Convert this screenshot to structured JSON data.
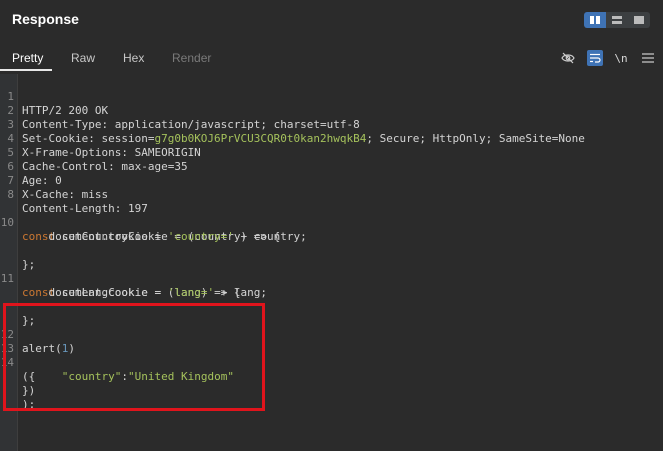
{
  "panel": {
    "title": "Response"
  },
  "tabs": [
    {
      "label": "Pretty",
      "state": "active"
    },
    {
      "label": "Raw",
      "state": "normal"
    },
    {
      "label": "Hex",
      "state": "normal"
    },
    {
      "label": "Render",
      "state": "disabled"
    }
  ],
  "toolbar": {
    "newline_label": "\\n"
  },
  "lines": {
    "l1": {
      "n": "1",
      "text": "HTTP/2 200 OK"
    },
    "l2": {
      "n": "2",
      "a": "Content-Type: application/javascript; charset=utf-8"
    },
    "l3": {
      "n": "3",
      "a": "Set-Cookie: session=",
      "b": "g7g0b0KOJ6PrVCU3CQR0t0kan2hwqkB4",
      "c": "; Secure; HttpOnly; SameSite=None"
    },
    "l4": {
      "n": "4",
      "a": "X-Frame-Options: SAMEORIGIN"
    },
    "l5": {
      "n": "5",
      "a": "Cache-Control: max-age=35"
    },
    "l6": {
      "n": "6",
      "a": "Age: 0"
    },
    "l7": {
      "n": "7",
      "a": "X-Cache: miss"
    },
    "l8": {
      "n": "8",
      "a": "Content-Length: 197"
    },
    "l10": {
      "n": "10",
      "kw": "const",
      "a": " setCountryCookie = (country) => {"
    },
    "l10b": {
      "a": "    document.cookie = ",
      "str": "'country='",
      "b": " + country;"
    },
    "l10c": {
      "a": "};"
    },
    "l11": {
      "n": "11",
      "kw": "const",
      "a": " setLangCookie = (lang) => {"
    },
    "l11b": {
      "a": "    document.cookie = ",
      "str": "'lang='",
      "b": " + lang;"
    },
    "l11c": {
      "a": "};"
    },
    "l12": {
      "n": "12",
      "a": "alert(",
      "num": "1",
      "b": ")"
    },
    "l13": {
      "n": "13"
    },
    "l14": {
      "n": "14",
      "a": "({"
    },
    "l14b": {
      "a": "      ",
      "key": "\"country\"",
      "b": ":",
      "val": "\"United Kingdom\""
    },
    "l14c": {
      "a": "})"
    },
    "l14d": {
      "a": ");"
    }
  },
  "colors": {
    "accent": "#3f73b5",
    "highlight_border": "#e0141c",
    "string": "#a5c25c",
    "keyword": "#cc7832"
  }
}
